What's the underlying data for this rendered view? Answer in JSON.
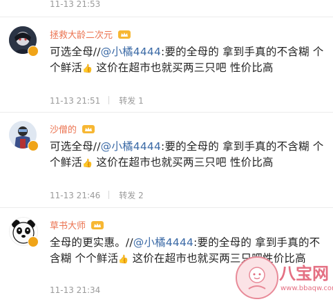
{
  "colors": {
    "name": "#eb7350",
    "mention": "#3b6aa6",
    "meta": "#9a9a9a",
    "verified": "#f0a418"
  },
  "top_meta": {
    "time": "11-13 21:53"
  },
  "comments": [
    {
      "username": "拯救大龄二次元",
      "segments": {
        "before": "可选全母//",
        "mention": "@小橘4444",
        "after": ":要的全母的 拿到手真的不含糊 个个鲜活",
        "after2": " 这价在超市也就买两三只吧 性价比高"
      },
      "time": "11-13 21:51",
      "repost_label": "转发",
      "repost_count": "1"
    },
    {
      "username": "沙僧的",
      "segments": {
        "before": "可选全母//",
        "mention": "@小橘4444",
        "after": ":要的全母的 拿到手真的不含糊 个个鲜活",
        "after2": " 这价在超市也就买两三只吧 性价比高"
      },
      "time": "11-13 21:46",
      "repost_label": "转发",
      "repost_count": "2"
    },
    {
      "username": "草书大师",
      "segments": {
        "before": "全母的更实惠。//",
        "mention": "@小橘4444",
        "after": ":要的全母的 拿到手真的不含糊 个个鲜活",
        "after2": " 这价在超市也就买两三只吧性价比高"
      },
      "time": "11-13 21:34"
    }
  ],
  "watermark": {
    "brand": "八宝网",
    "url": "www.bbaqw.com"
  }
}
